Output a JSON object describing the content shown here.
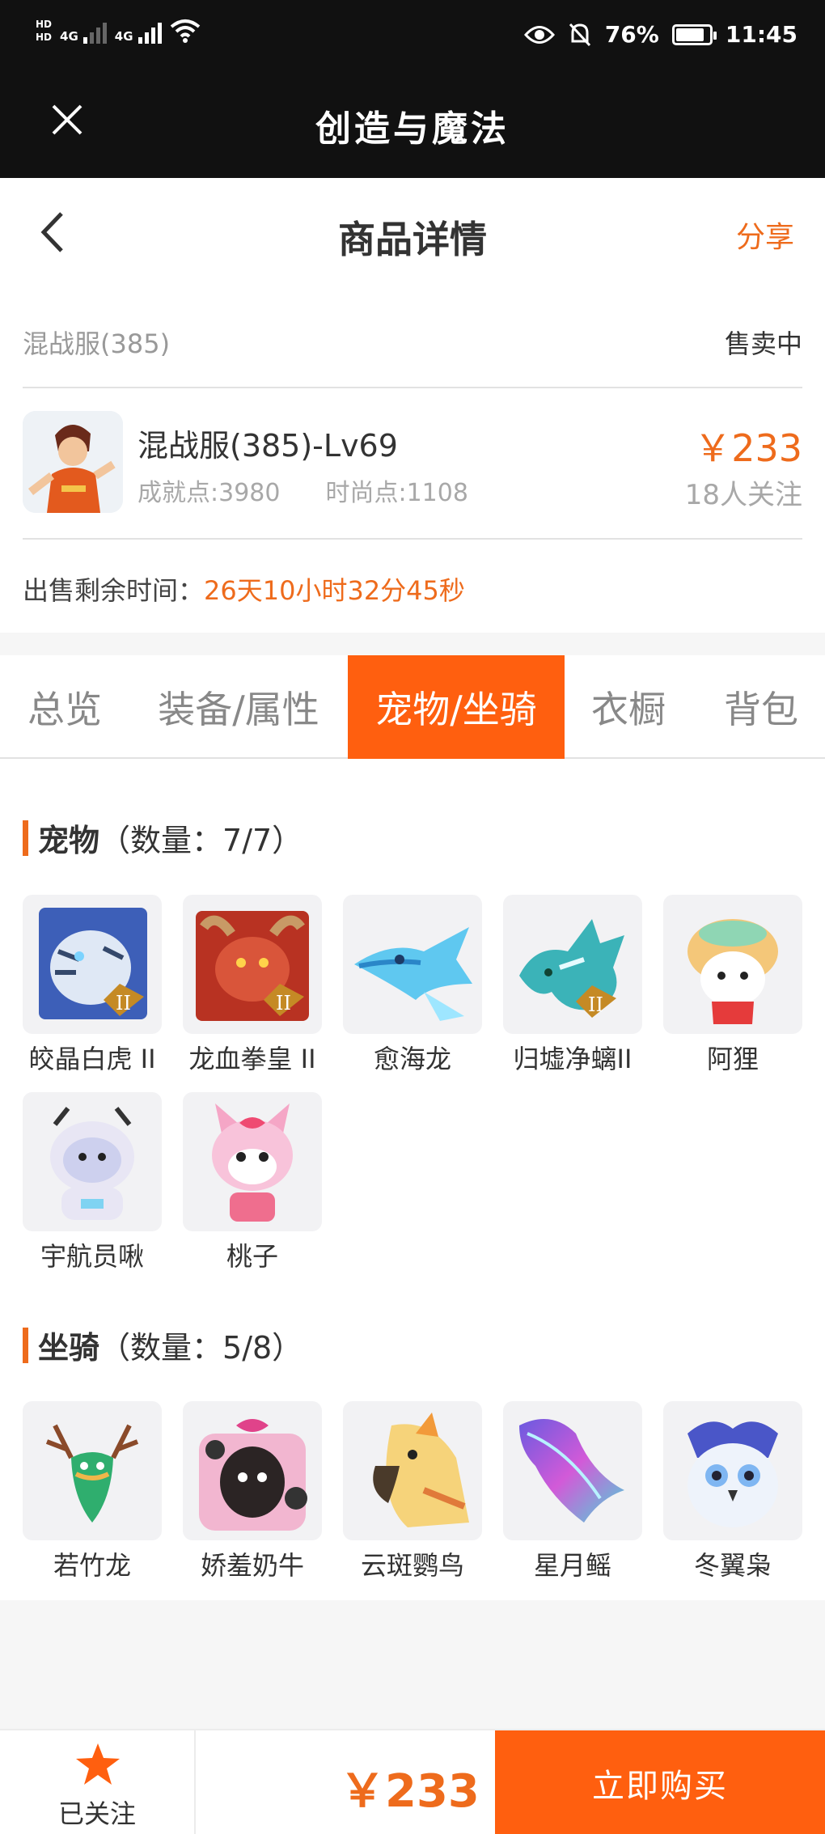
{
  "status_bar": {
    "network_left": "HD",
    "net1": "4G",
    "net2": "4G",
    "battery": "76%",
    "time": "11:45"
  },
  "app_bar": {
    "title": "创造与魔法"
  },
  "header": {
    "title": "商品详情",
    "share": "分享"
  },
  "listing": {
    "server": "混战服(385)",
    "status": "售卖中",
    "name": "混战服(385)-Lv69",
    "achievement": "成就点:3980",
    "fashion": "时尚点:1108",
    "price": "￥233",
    "followers": "18人关注",
    "time_label": "出售剩余时间：",
    "time_value": "26天10小时32分45秒"
  },
  "tabs": [
    "总览",
    "装备/属性",
    "宠物/坐骑",
    "衣橱",
    "背包"
  ],
  "active_tab": 2,
  "pets": {
    "title": "宠物",
    "count": "（数量：7/7）",
    "items": [
      "皎晶白虎 II",
      "龙血拳皇 II",
      "愈海龙",
      "归墟净螭II",
      "阿狸",
      "宇航员啾",
      "桃子"
    ]
  },
  "mounts": {
    "title": "坐骑",
    "count": "（数量：5/8）",
    "items": [
      "若竹龙",
      "娇羞奶牛",
      "云斑鹦鸟",
      "星月鳐",
      "冬翼枭"
    ]
  },
  "bottom": {
    "follow_label": "已关注",
    "price": "￥233",
    "buy_label": "立即购买"
  },
  "colors": {
    "accent": "#ee6b1c",
    "tab_active": "#ff5f0f",
    "dark": "#111111"
  }
}
